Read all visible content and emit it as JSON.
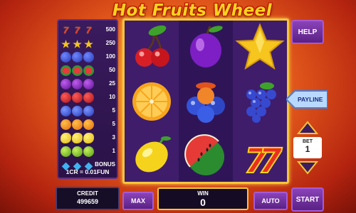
{
  "title": "Hot Fruits Wheel",
  "paytable": {
    "rows": [
      {
        "value": "500",
        "symbol": "seven-icon",
        "color": "#e0341f"
      },
      {
        "value": "250",
        "symbol": "star-icon",
        "color": "#f6c51e"
      },
      {
        "value": "100",
        "symbol": "grape-icon",
        "color": "#3b4fd6"
      },
      {
        "value": "50",
        "symbol": "watermelon-icon",
        "color": "#2e9a3b"
      },
      {
        "value": "25",
        "symbol": "plum-icon",
        "color": "#8a2bd0"
      },
      {
        "value": "10",
        "symbol": "cherry-icon",
        "color": "#d8232a"
      },
      {
        "value": "5",
        "symbol": "blueberry-icon",
        "color": "#3f5fe0"
      },
      {
        "value": "5",
        "symbol": "orange-icon",
        "color": "#f5891b"
      },
      {
        "value": "3",
        "symbol": "lemon-icon",
        "color": "#f4d31c"
      },
      {
        "value": "1",
        "symbol": "lime-icon",
        "color": "#7bc62b"
      },
      {
        "value": "BONUS",
        "symbol": "diamond-icon",
        "color": "#31a8e6"
      }
    ],
    "rate": "1CR = 0.01FUN"
  },
  "reels": [
    [
      "cherry",
      "orange",
      "lemon"
    ],
    [
      "plum",
      "blueberries",
      "watermelon"
    ],
    [
      "star",
      "grapes",
      "seven"
    ]
  ],
  "buttons": {
    "help": "HELP",
    "payline": "PAYLINE",
    "bet_label": "BET",
    "bet_value": "1",
    "start": "START",
    "max": "MAX",
    "auto": "AUTO"
  },
  "credit": {
    "label": "CREDIT",
    "value": "499659"
  },
  "win": {
    "label": "WIN",
    "value": "0"
  }
}
